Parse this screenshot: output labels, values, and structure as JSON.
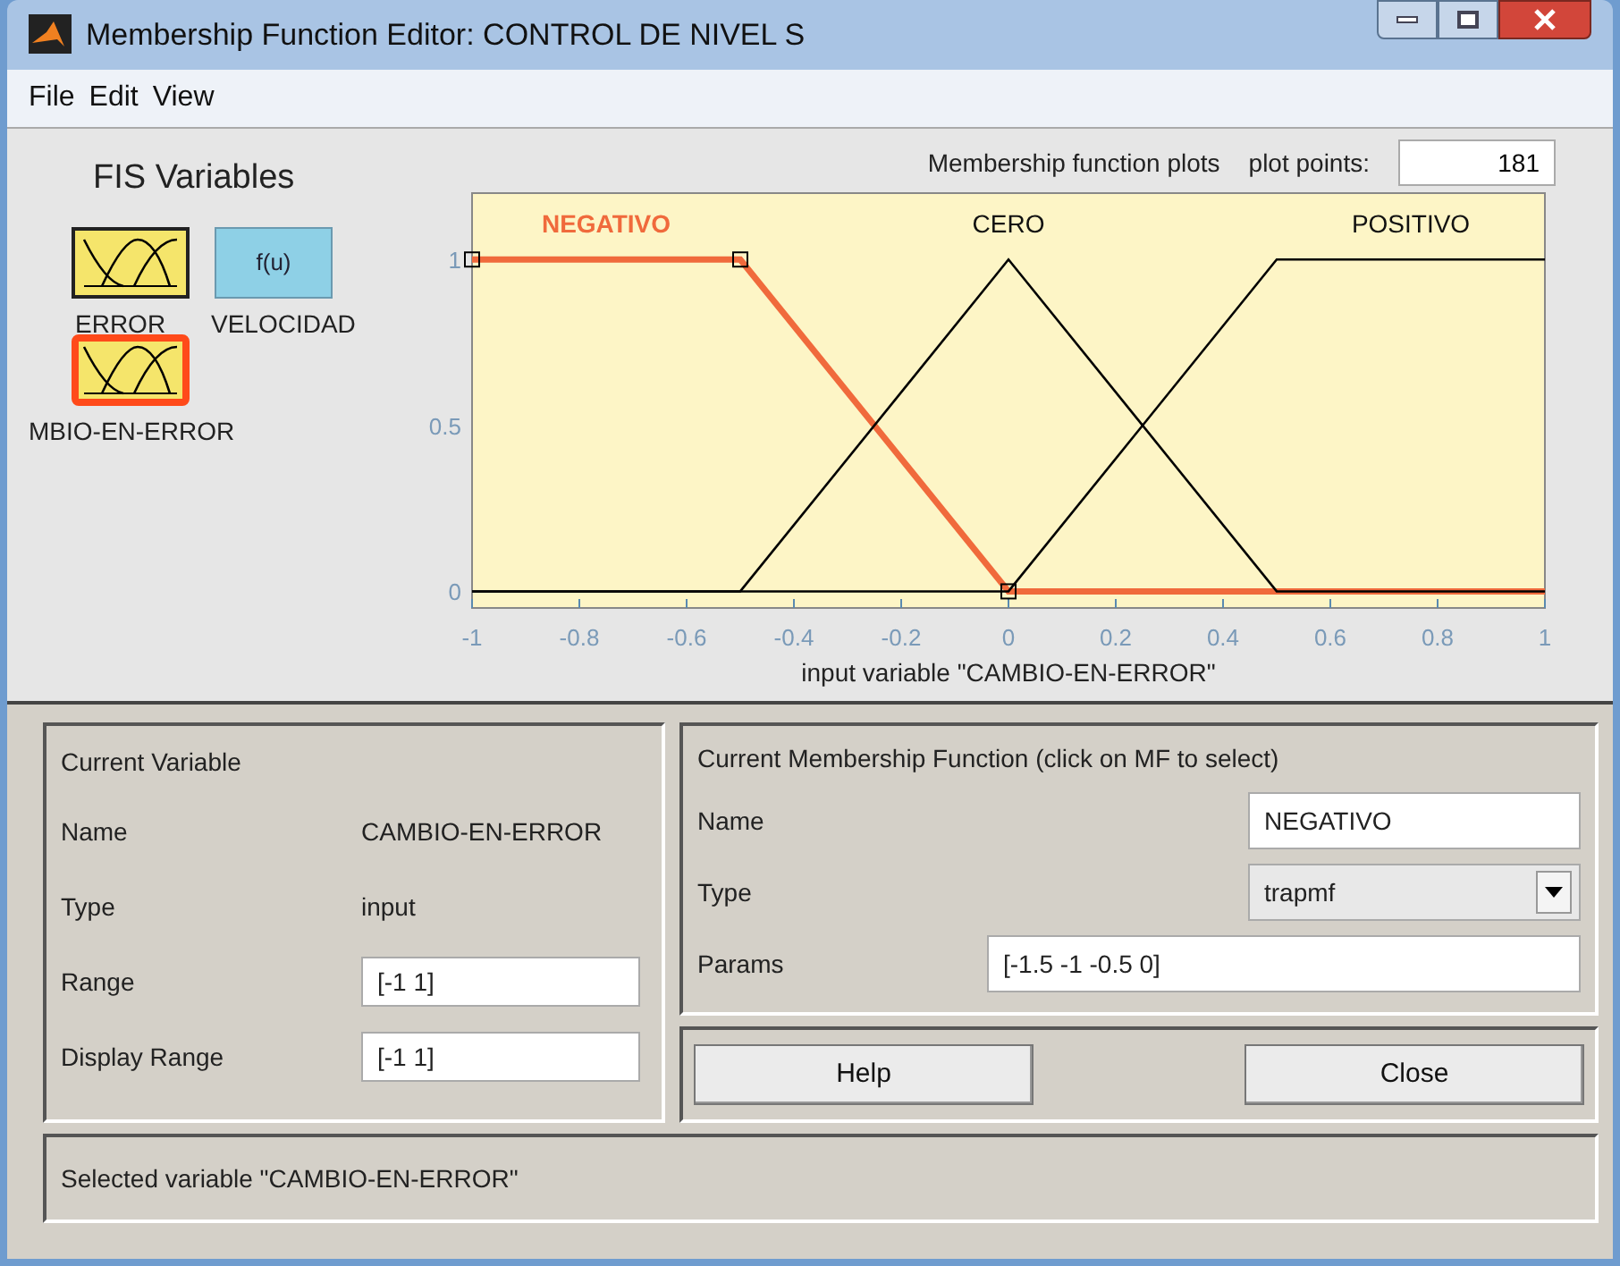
{
  "window": {
    "title": "Membership Function Editor: CONTROL DE NIVEL S"
  },
  "menu": [
    "File",
    "Edit",
    "View"
  ],
  "fis_variables": {
    "title": "FIS Variables",
    "items": [
      {
        "label": "ERROR",
        "kind": "mf",
        "selected": false
      },
      {
        "label": "VELOCIDAD",
        "kind": "output",
        "icon_text": "f(u)",
        "selected": false
      },
      {
        "label": "MBIO-EN-ERROR",
        "kind": "mf",
        "selected": true
      }
    ]
  },
  "plot": {
    "title": "Membership function plots",
    "plot_points_label": "plot points:",
    "plot_points": "181",
    "mf_selected": [
      true,
      false,
      false
    ],
    "chart_data": {
      "type": "line",
      "xlabel": "input variable \"CAMBIO-EN-ERROR\"",
      "x": [
        -1,
        -0.5,
        0,
        0.5,
        1
      ],
      "xlim": [
        -1,
        1
      ],
      "ylim": [
        -0.05,
        1.2
      ],
      "xticks": [
        -1,
        -0.8,
        -0.6,
        -0.4,
        -0.2,
        0,
        0.2,
        0.4,
        0.6,
        0.8,
        1
      ],
      "yticks": [
        0,
        0.5,
        1
      ],
      "series": [
        {
          "name": "NEGATIVO",
          "color": "#f06a3c",
          "values": [
            1,
            1,
            0,
            0,
            0
          ]
        },
        {
          "name": "CERO",
          "color": "#000000",
          "values": [
            0,
            0,
            1,
            0,
            0
          ]
        },
        {
          "name": "POSITIVO",
          "color": "#000000",
          "values": [
            0,
            0,
            0,
            1,
            1
          ]
        }
      ]
    }
  },
  "current_variable": {
    "title": "Current Variable",
    "name_label": "Name",
    "name": "CAMBIO-EN-ERROR",
    "type_label": "Type",
    "type": "input",
    "range_label": "Range",
    "range": "[-1 1]",
    "display_range_label": "Display Range",
    "display_range": "[-1 1]"
  },
  "current_mf": {
    "title": "Current Membership Function (click on MF to select)",
    "name_label": "Name",
    "name": "NEGATIVO",
    "type_label": "Type",
    "type": "trapmf",
    "params_label": "Params",
    "params": "[-1.5 -1 -0.5 0]"
  },
  "buttons": [
    "Help",
    "Close"
  ],
  "status": "Selected variable \"CAMBIO-EN-ERROR\""
}
